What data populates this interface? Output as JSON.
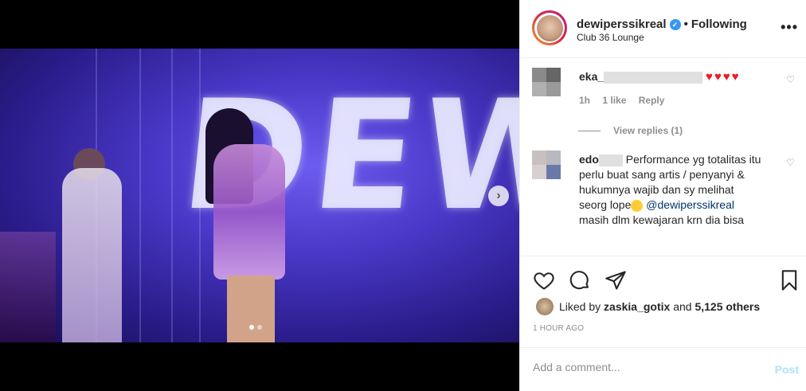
{
  "header": {
    "username": "dewiperssikreal",
    "separator": "•",
    "follow_status": "Following",
    "location": "Club 36 Lounge",
    "more_icon": "•••"
  },
  "media": {
    "screen_text": "DEWI",
    "next_arrow": "›",
    "carousel_position": 1,
    "carousel_total": 2
  },
  "comments": [
    {
      "user": "eka_",
      "emoji": "♥♥♥♥",
      "time": "1h",
      "likes": "1 like",
      "reply": "Reply",
      "view_replies": "View replies (1)"
    },
    {
      "user": "edo",
      "text_1": "Performance yg totalitas itu perlu buat sang artis / penyanyi & hukumnya wajib dan sy melihat seorg lope",
      "mention": "@dewiperssikreal",
      "text_2": "masih dlm kewajaran krn dia bisa"
    }
  ],
  "likes": {
    "prefix": "Liked by",
    "user": "zaskia_gotix",
    "conj": "and",
    "others": "5,125 others"
  },
  "timestamp": "1 HOUR AGO",
  "add_comment": {
    "placeholder": "Add a comment...",
    "post_label": "Post"
  },
  "colors": {
    "link": "#003569",
    "muted": "#8e8e8e",
    "post_disabled": "#b2dffc",
    "verified": "#3897f0"
  }
}
